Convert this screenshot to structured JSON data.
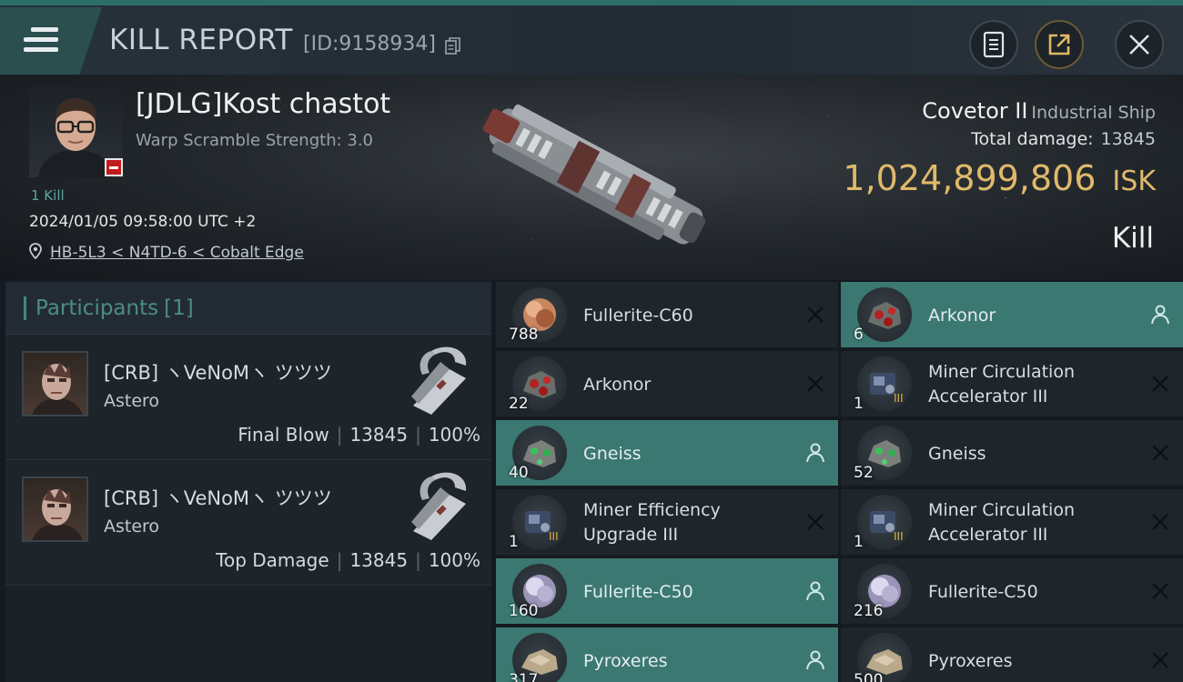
{
  "header": {
    "title": "KILL REPORT",
    "report_id": "[ID:9158934]",
    "buttons": [
      "clipboard-icon",
      "share-icon",
      "close-icon"
    ]
  },
  "victim": {
    "name": "[JDLG]Kost chastot",
    "warp_scramble": "Warp Scramble Strength: 3.0",
    "kill_count": "1 Kill",
    "date": "2024/01/05 09:58:00 UTC +2",
    "location": "HB-5L3 < N4TD-6 < Cobalt Edge",
    "ship_name": "Covetor II",
    "ship_class": "Industrial Ship",
    "total_damage_label": "Total damage:",
    "total_damage": "13845",
    "isk_value": "1,024,899,806",
    "isk_unit": "ISK",
    "result": "Kill"
  },
  "participants": {
    "label": "Participants",
    "count": "[1]",
    "rows": [
      {
        "name": "[CRB] ヽVeNoMヽ ツツツ",
        "ship": "Astero",
        "role": "Final Blow",
        "damage": "13845",
        "percent": "100%"
      },
      {
        "name": "[CRB] ヽVeNoMヽ ツツツ",
        "ship": "Astero",
        "role": "Top Damage",
        "damage": "13845",
        "percent": "100%"
      }
    ]
  },
  "loot": {
    "left": [
      {
        "name": "Fullerite-C60",
        "qty": "788",
        "status": "destroyed",
        "icon": "gas-cloud-orange-icon"
      },
      {
        "name": "Arkonor",
        "qty": "22",
        "status": "destroyed",
        "icon": "ore-red-icon"
      },
      {
        "name": "Gneiss",
        "qty": "40",
        "status": "dropped",
        "icon": "ore-green-icon"
      },
      {
        "name": "Miner Efficiency Upgrade III",
        "qty": "1",
        "status": "destroyed",
        "icon": "module-icon"
      },
      {
        "name": "Fullerite-C50",
        "qty": "160",
        "status": "dropped",
        "icon": "gas-cloud-white-icon"
      },
      {
        "name": "Pyroxeres",
        "qty": "317",
        "status": "dropped",
        "icon": "ore-tan-icon"
      }
    ],
    "right": [
      {
        "name": "Arkonor",
        "qty": "6",
        "status": "dropped",
        "icon": "ore-red-icon"
      },
      {
        "name": "Miner Circulation Accelerator III",
        "qty": "1",
        "status": "destroyed",
        "icon": "module-icon"
      },
      {
        "name": "Gneiss",
        "qty": "52",
        "status": "destroyed",
        "icon": "ore-green-icon"
      },
      {
        "name": "Miner Circulation Accelerator III",
        "qty": "1",
        "status": "destroyed",
        "icon": "module-icon"
      },
      {
        "name": "Fullerite-C50",
        "qty": "216",
        "status": "destroyed",
        "icon": "gas-cloud-white-icon"
      },
      {
        "name": "Pyroxeres",
        "qty": "500",
        "status": "destroyed",
        "icon": "ore-tan-icon"
      }
    ]
  },
  "colors": {
    "accent": "#3b7871",
    "isk": "#e0b96a",
    "badge": "#c11c1c"
  }
}
